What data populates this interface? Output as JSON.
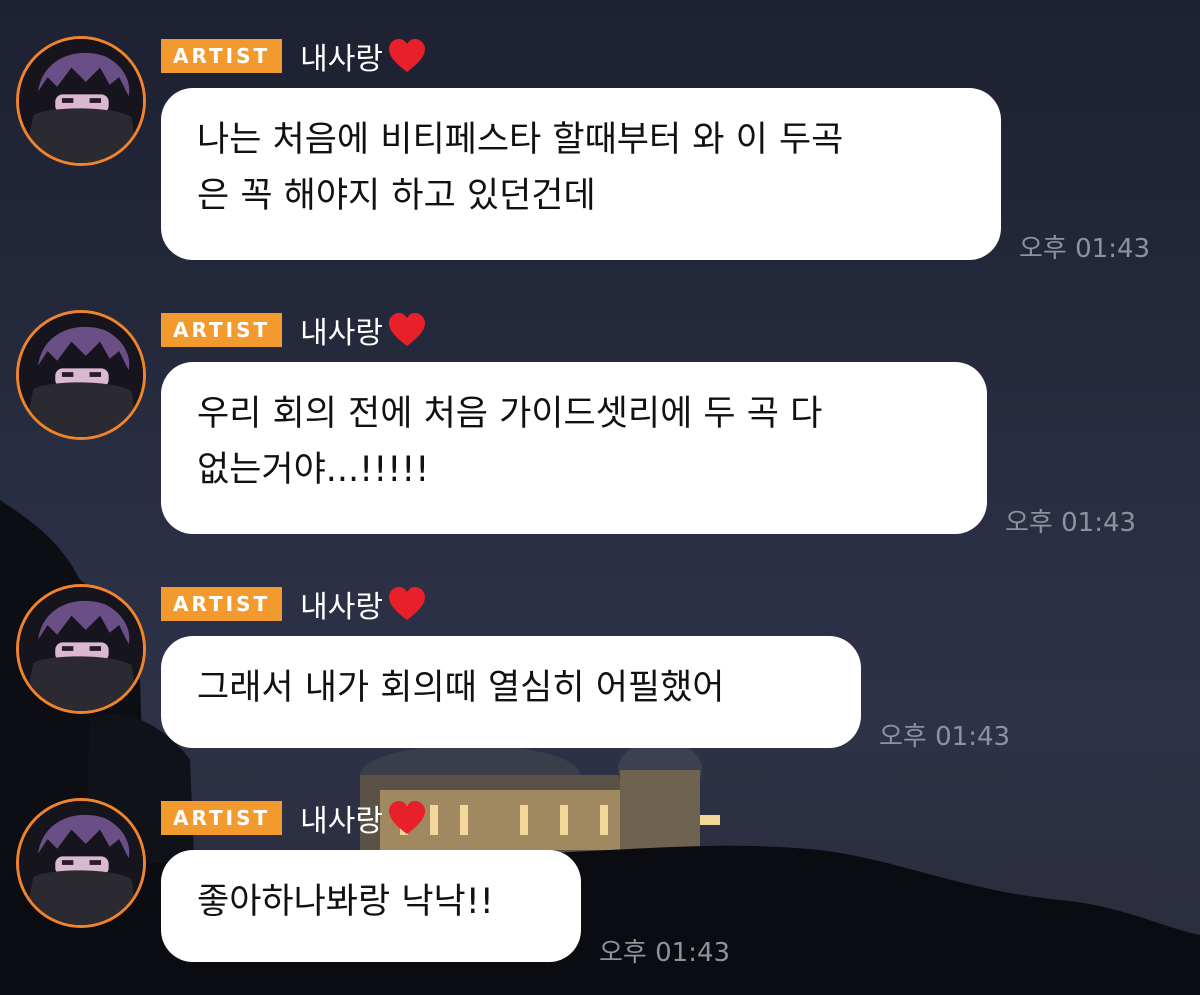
{
  "chat": {
    "messages": [
      {
        "badge": "ARTIST",
        "sender": "내사랑",
        "heart_icon": "red-heart-icon",
        "text": "나는 처음에 비티페스타 할때부터 와 이 두곡\n은 꼭 해야지 하고 있던건데",
        "time": "오후 01:43"
      },
      {
        "badge": "ARTIST",
        "sender": "내사랑",
        "heart_icon": "red-heart-icon",
        "text": "우리 회의 전에 처음 가이드셋리에 두 곡 다\n없는거야...!!!!!",
        "time": "오후 01:43"
      },
      {
        "badge": "ARTIST",
        "sender": "내사랑",
        "heart_icon": "red-heart-icon",
        "text": "그래서 내가 회의때 열심히 어필했어",
        "time": "오후 01:43"
      },
      {
        "badge": "ARTIST",
        "sender": "내사랑",
        "heart_icon": "red-heart-icon",
        "text": "좋아하나봐랑 낙낙!!",
        "time": "오후 01:43"
      }
    ]
  },
  "colors": {
    "badge": "#f39a2e",
    "avatar_ring": "#f0842c",
    "bubble": "#ffffff",
    "timestamp": "#8d91a0"
  }
}
